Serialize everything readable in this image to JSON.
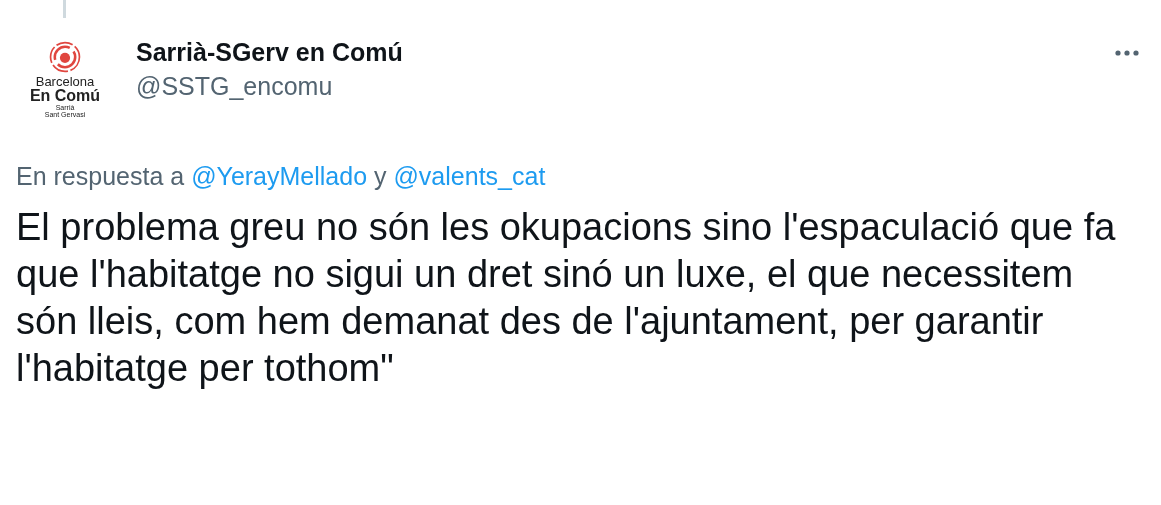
{
  "tweet": {
    "author": {
      "name": "Sarrià-SGerv en Comú",
      "handle": "@SSTG_encomu",
      "avatar_logo_lines": [
        {
          "text": "Barcelona",
          "kind": "small"
        },
        {
          "text": "En Comú",
          "kind": "bold"
        },
        {
          "text": "Sarrià",
          "kind": "tiny"
        },
        {
          "text": "Sant Gervasi",
          "kind": "tiny"
        }
      ]
    },
    "reply_to": {
      "prefix": "En respuesta a",
      "users": [
        "@YerayMellado",
        "@valents_cat"
      ],
      "joiner": "y"
    },
    "text": "El problema greu no són les okupacions sino l'espaculació que fa que l'habitatge no sigui un dret sinó un luxe, el que necessitem són lleis, com hem demanat des de l'ajuntament, per garantir l'habitatge per tothom\""
  }
}
